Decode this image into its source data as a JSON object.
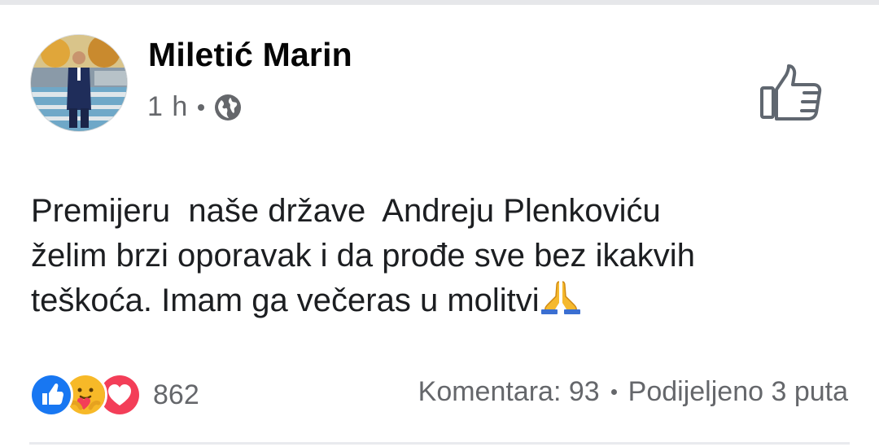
{
  "post": {
    "author": "Miletić Marin",
    "time": "1 h",
    "privacy_icon": "globe-icon",
    "like_icon": "thumbs-up-outline-icon",
    "text_lines": [
      "Premijeru  naše države  Andreju Plenkoviću",
      "želim brzi oporavak i da prođe sve bez ikakvih",
      "teškoća. Imam ga večeras u molitvi"
    ],
    "emoji": "folded-hands-icon"
  },
  "reactions": {
    "icons": [
      "like-reaction-icon",
      "care-reaction-icon",
      "love-reaction-icon"
    ],
    "count": "862"
  },
  "stats": {
    "comments": "Komentara: 93",
    "shares": "Podijeljeno 3 puta"
  },
  "colors": {
    "like_blue": "#1877f2",
    "love_red": "#f33e58",
    "care_yellow": "#f7b928",
    "secondary_text": "#65676b"
  }
}
